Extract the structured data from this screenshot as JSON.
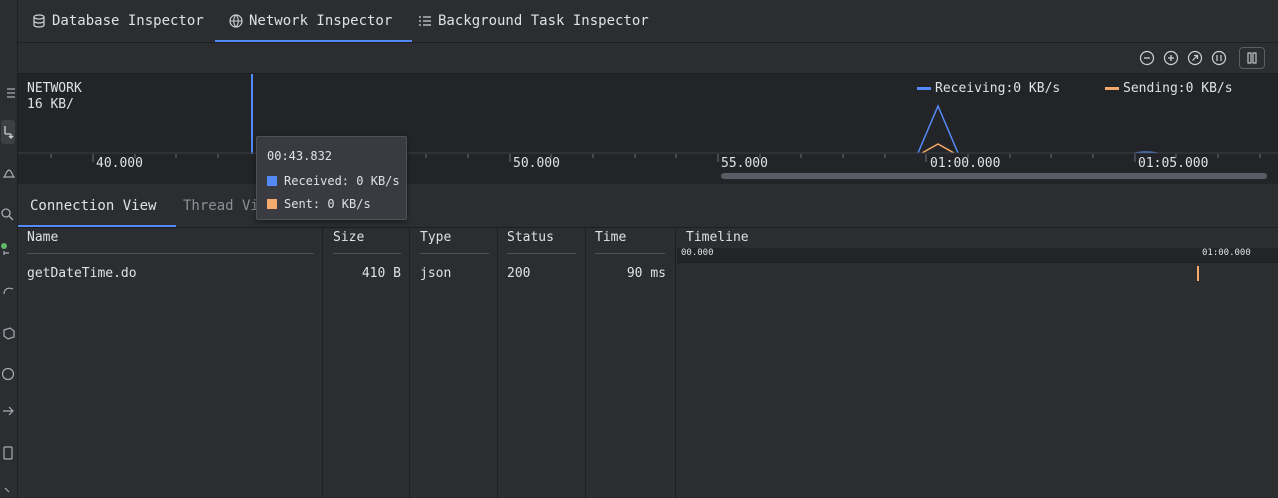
{
  "tabs": [
    {
      "label": "Database Inspector",
      "icon": "database-icon",
      "active": false
    },
    {
      "label": "Network Inspector",
      "icon": "globe-icon",
      "active": true
    },
    {
      "label": "Background Task Inspector",
      "icon": "list-icon",
      "active": false
    }
  ],
  "toolbar": {
    "zoom_out": "zoom-out-icon",
    "zoom_in": "zoom-in-icon",
    "reset_zoom": "reset-zoom-icon",
    "zoom_to_selection": "zoom-to-selection-icon",
    "pause": "pause-icon"
  },
  "chart": {
    "title": "NETWORK",
    "scale_label": "16 KB/",
    "legend": [
      {
        "label": "Receiving:",
        "value": "0 KB/s",
        "color": "#548af7"
      },
      {
        "label": "Sending:",
        "value": "0 KB/s",
        "color": "#f5a96a"
      }
    ],
    "axis_ticks": [
      "40.000",
      "50.000",
      "55.000",
      "01:00.000",
      "01:05.000"
    ]
  },
  "tooltip": {
    "time": "00:43.832",
    "received_label": "Received:",
    "received_value": "0 KB/s",
    "sent_label": "Sent:",
    "sent_value": "0 KB/s",
    "received_color": "#548af7",
    "sent_color": "#f5a96a"
  },
  "subtabs": [
    {
      "label": "Connection View",
      "active": true
    },
    {
      "label": "Thread Vi",
      "active": false
    }
  ],
  "table": {
    "columns": [
      "Name",
      "Size",
      "Type",
      "Status",
      "Time",
      "Timeline"
    ],
    "timeline_ticks": [
      "00.000",
      "01:00.000"
    ],
    "rows": [
      {
        "name": "getDateTime.do",
        "size": "410 B",
        "type": "json",
        "status": "200",
        "time": "90 ms"
      }
    ]
  },
  "colors": {
    "accent": "#548af7",
    "sending": "#f5a96a",
    "background": "#2b2d30",
    "chart_bg": "#232427"
  }
}
